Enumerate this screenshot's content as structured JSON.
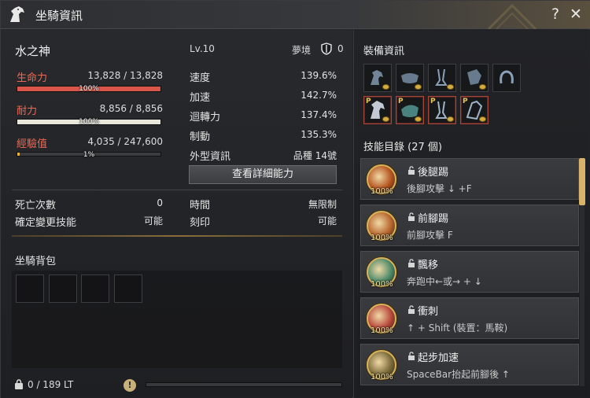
{
  "window": {
    "title": "坐騎資訊",
    "help": "?",
    "close": "✕"
  },
  "horse": {
    "name": "水之神",
    "level": "Lv.10",
    "dream_label": "夢境",
    "dream_value": "0"
  },
  "stats": {
    "hp": {
      "label": "生命力",
      "value": "13,828 / 13,828",
      "percent": "100%",
      "fraction": 1.0,
      "color": "#d9574a"
    },
    "stamina": {
      "label": "耐力",
      "value": "8,856 / 8,856",
      "percent": "100%",
      "fraction": 1.0,
      "color": "#e9e6dc"
    },
    "exp": {
      "label": "經驗值",
      "value": "4,035 / 247,600",
      "percent": "1%",
      "fraction": 0.0163,
      "color": "#e6b23d"
    }
  },
  "attributes": [
    {
      "label": "速度",
      "value": "139.6%"
    },
    {
      "label": "加速",
      "value": "142.7%"
    },
    {
      "label": "迴轉力",
      "value": "137.4%"
    },
    {
      "label": "制動",
      "value": "135.3%"
    },
    {
      "label": "外型資訊",
      "value": "品種 14號"
    }
  ],
  "detail_button": "查看詳細能力",
  "misc": {
    "death_label": "死亡次數",
    "death_value": "0",
    "skill_change_label": "確定變更技能",
    "skill_change_value": "可能",
    "time_label": "時間",
    "time_value": "無限制",
    "imprint_label": "刻印",
    "imprint_value": "可能"
  },
  "bag": {
    "title": "坐騎背包",
    "weight": "0 / 189 LT",
    "warn": "!"
  },
  "equipment": {
    "title": "裝備資訊",
    "top_row": [
      {
        "icon": "horse-head-armor-icon",
        "p": ""
      },
      {
        "icon": "saddle-icon",
        "p": ""
      },
      {
        "icon": "stirrups-icon",
        "p": ""
      },
      {
        "icon": "horse-armor-icon",
        "p": ""
      },
      {
        "icon": "horseshoe-icon",
        "p": ""
      }
    ],
    "bottom_row": [
      {
        "icon": "p-horse-head-icon",
        "p": "P"
      },
      {
        "icon": "p-saddle-icon",
        "p": "P"
      },
      {
        "icon": "p-stirrups-icon",
        "p": "P"
      },
      {
        "icon": "p-horse-armor-icon",
        "p": "P"
      }
    ]
  },
  "skills": {
    "title": "技能目錄 (27 個)",
    "items": [
      {
        "name": "後腿踢",
        "key": "後腳攻擊 ↓ +F",
        "pct": "100%",
        "color": "#b5541f"
      },
      {
        "name": "前腳踢",
        "key": "前腳攻擊 F",
        "pct": "100%",
        "color": "#b8662e"
      },
      {
        "name": "飄移",
        "key": "奔跑中←或→ + ↓",
        "pct": "100%",
        "color": "#4c8a6a"
      },
      {
        "name": "衝刺",
        "key": "↑ + Shift (裝置：馬鞍)",
        "pct": "100%",
        "color": "#b8483c"
      },
      {
        "name": "起步加速",
        "key": "SpaceBar抬起前腳後 ↑",
        "pct": "100%",
        "color": "#7a6a3a"
      }
    ]
  }
}
